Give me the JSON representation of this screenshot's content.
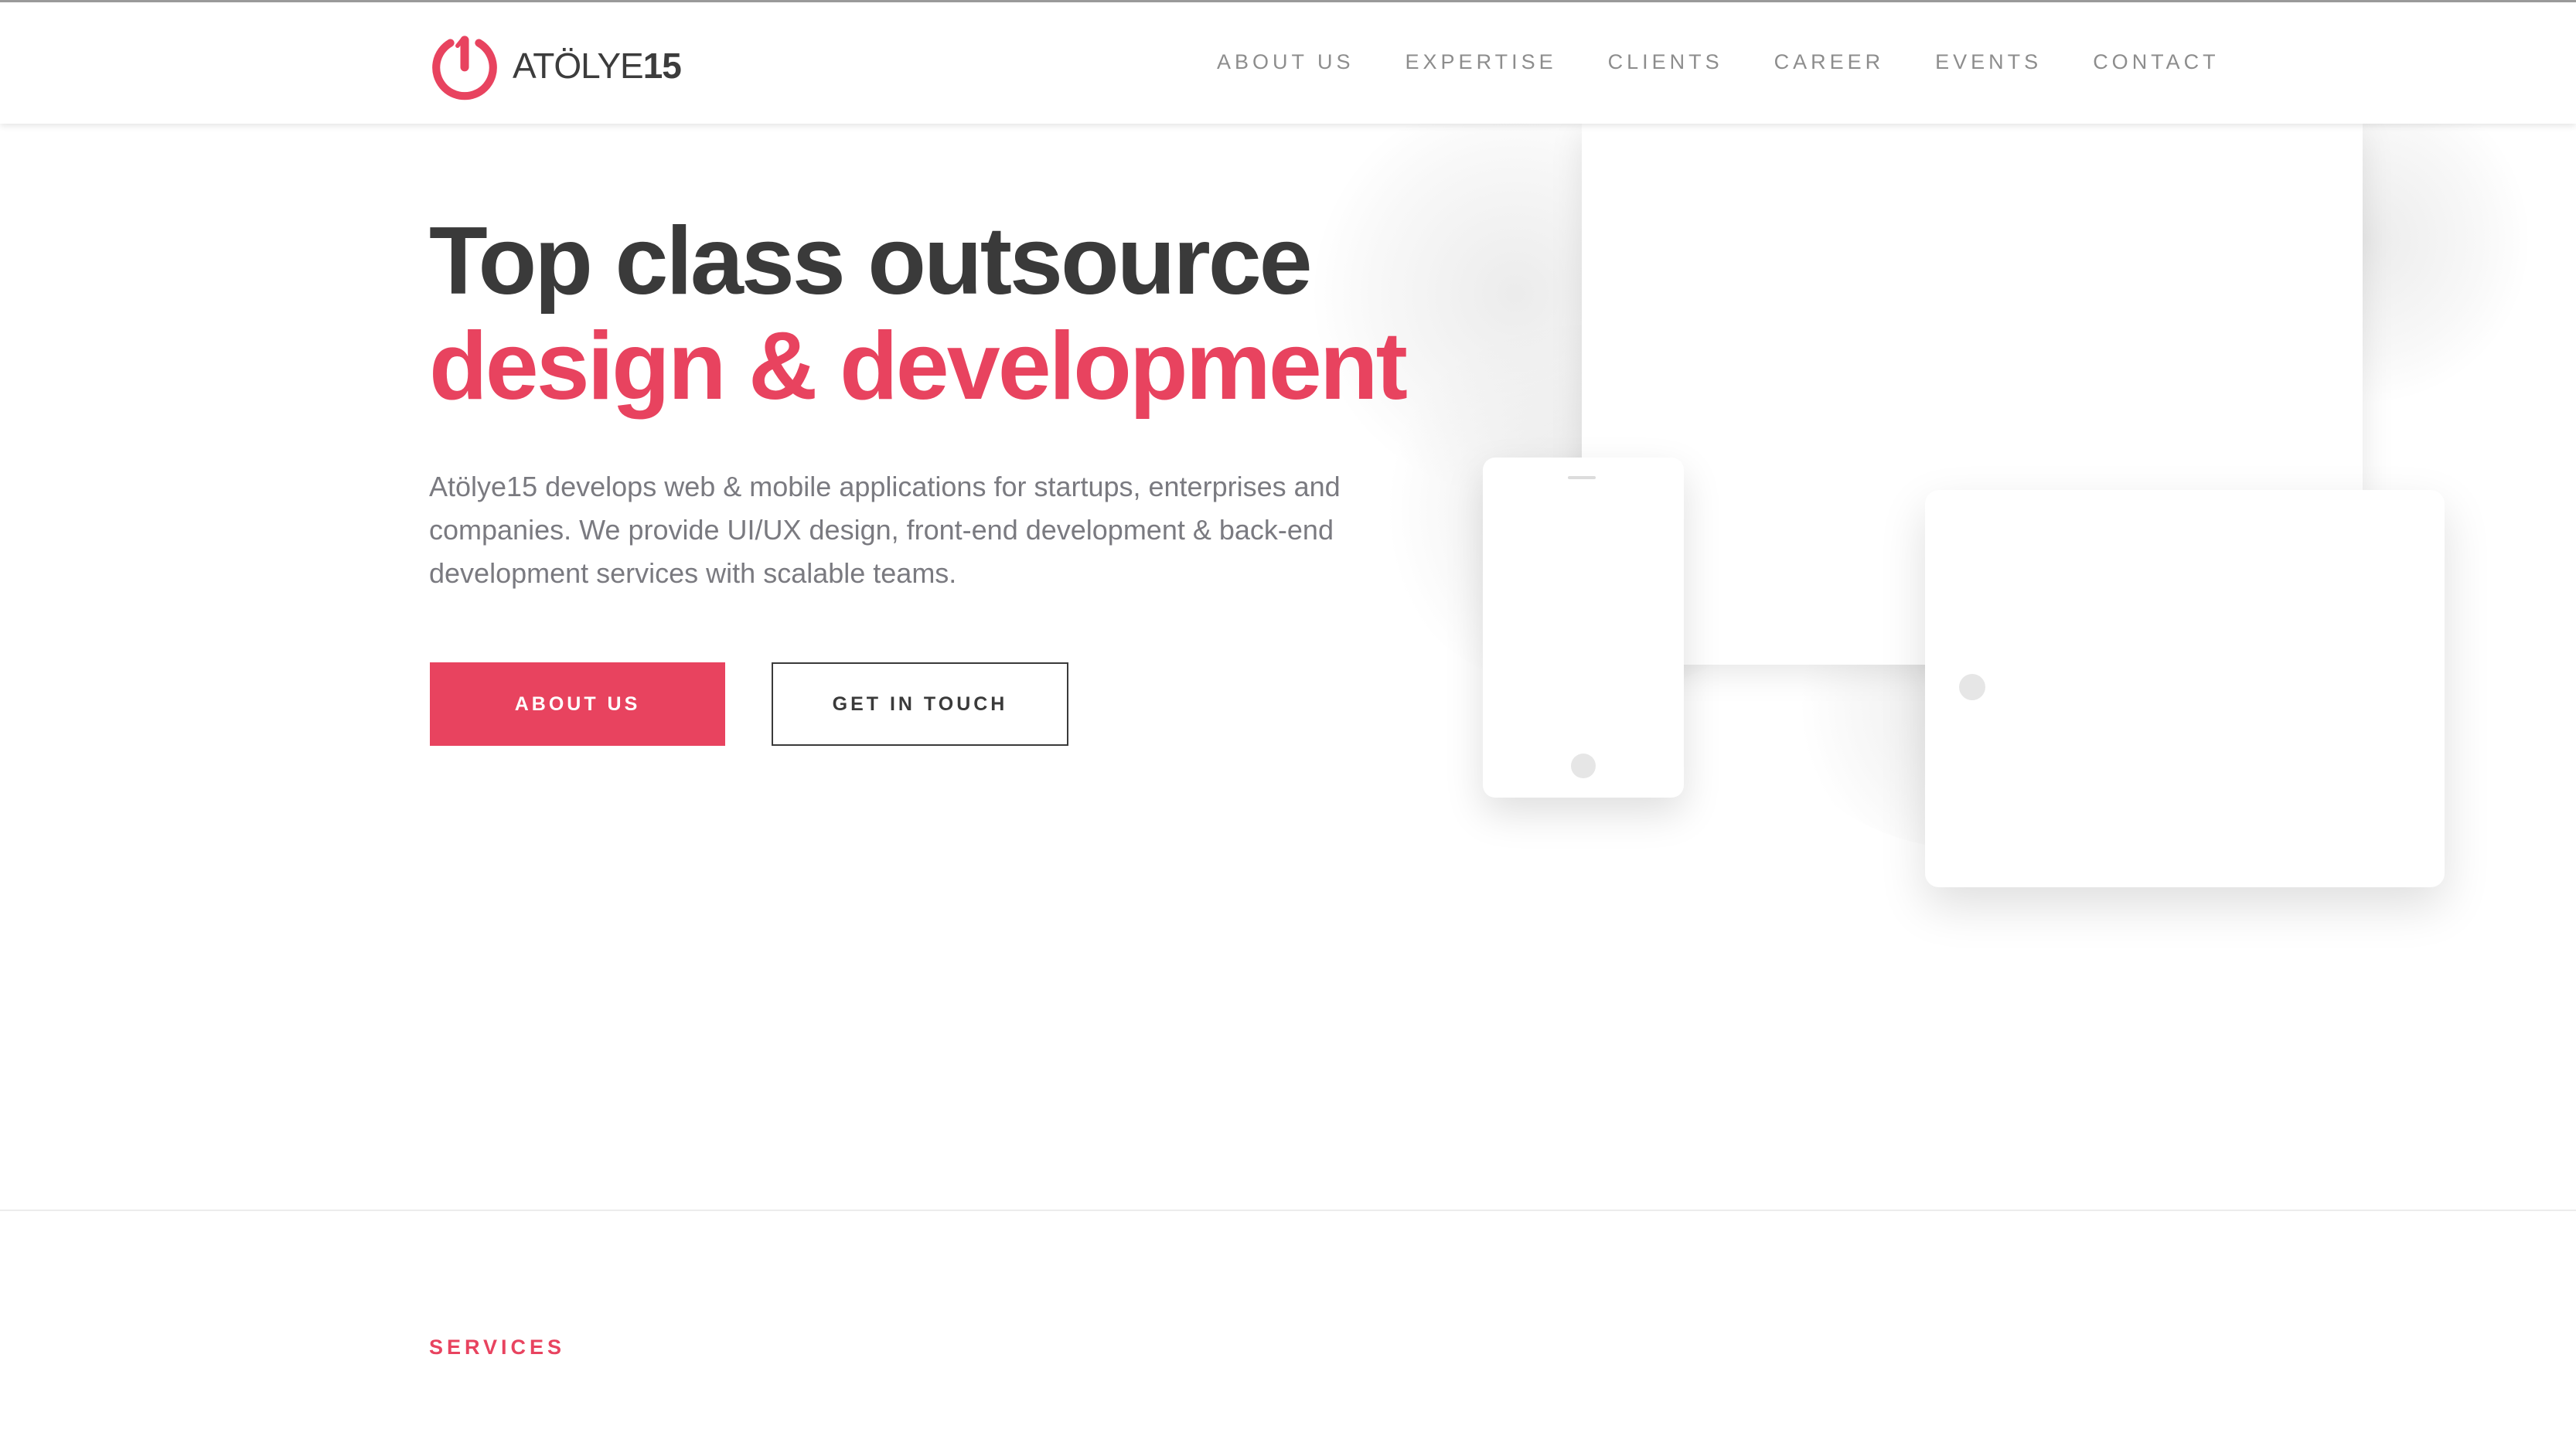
{
  "brand": {
    "logo_text": "ATÖLYE",
    "logo_number": "15",
    "accent_color": "#e8435f",
    "logo_icon": "power-icon"
  },
  "nav": {
    "items": [
      {
        "label": "ABOUT US"
      },
      {
        "label": "EXPERTISE"
      },
      {
        "label": "CLIENTS"
      },
      {
        "label": "CAREER"
      },
      {
        "label": "EVENTS"
      },
      {
        "label": "CONTACT"
      }
    ]
  },
  "hero": {
    "title_line1": "Top class outsource",
    "title_line2": "design & development",
    "description": "Atölye15 develops web & mobile applications for startups, enterprises and companies. We provide UI/UX design, front-end development & back-end development services with scalable teams.",
    "primary_button": "ABOUT US",
    "secondary_button": "GET IN TOUCH"
  },
  "services": {
    "label": "SERVICES"
  }
}
